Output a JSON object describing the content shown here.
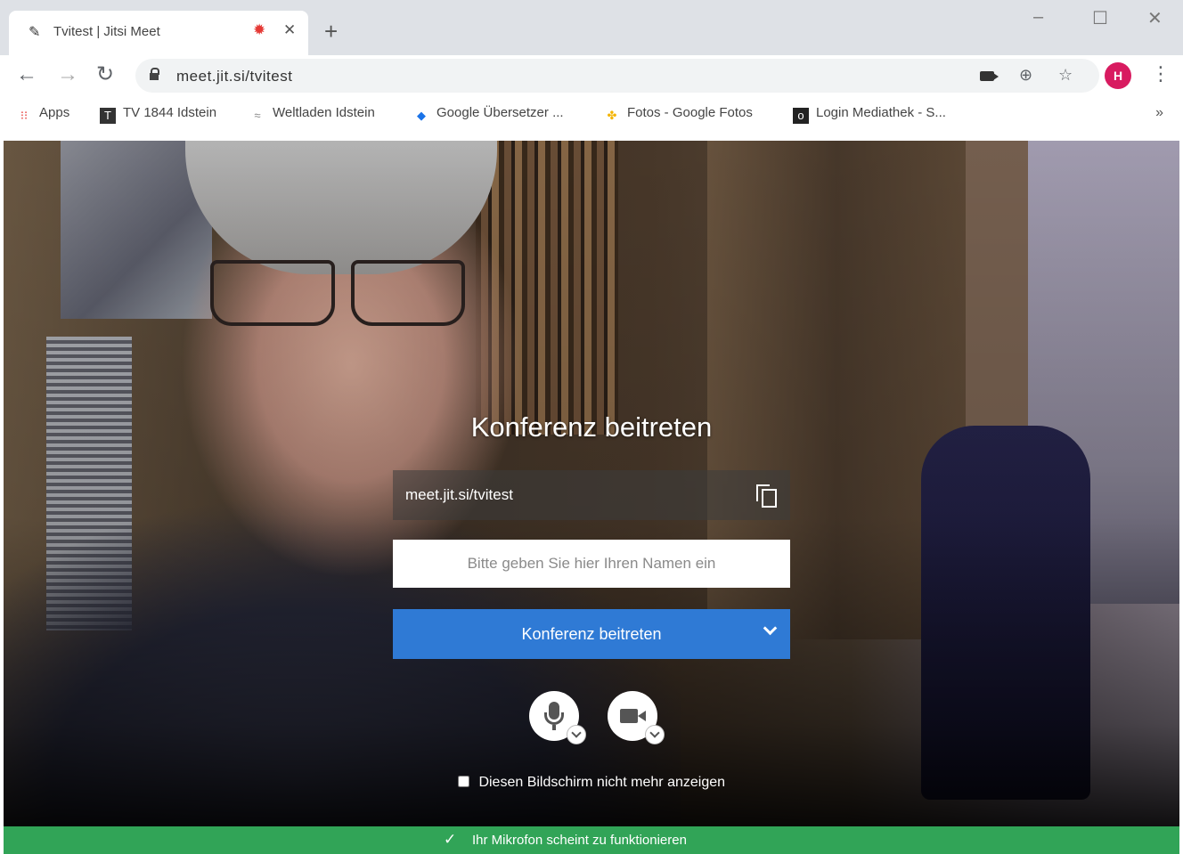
{
  "browser": {
    "tab": {
      "title": "Tvitest | Jitsi Meet",
      "favicon": "jitsi-icon",
      "audio_icon": "audio-playing-icon"
    },
    "new_tab_label": "+",
    "window_controls": {
      "minimize": "–",
      "maximize": "☐",
      "close": "✕"
    },
    "address": {
      "url": "meet.jit.si/tvitest"
    },
    "profile_initial": "H",
    "bookmarks": [
      {
        "label": "Apps",
        "icon": "apps-grid-icon"
      },
      {
        "label": "TV 1844 Idstein",
        "icon": "tv-club-icon"
      },
      {
        "label": "Weltladen Idstein",
        "icon": "weltladen-icon"
      },
      {
        "label": "Google Übersetzer ...",
        "icon": "translate-icon"
      },
      {
        "label": "Fotos - Google Fotos",
        "icon": "google-photos-icon"
      },
      {
        "label": "Login Mediathek - S...",
        "icon": "mediathek-icon"
      }
    ],
    "bookmarks_more": "»"
  },
  "meeting": {
    "title": "Konferenz beitreten",
    "room_url": "meet.jit.si/tvitest",
    "name_placeholder": "Bitte geben Sie hier Ihren Namen ein",
    "join_button_label": "Konferenz beitreten",
    "dont_show_label": "Diesen Bildschirm nicht mehr anzeigen"
  },
  "status": {
    "icon": "check-icon",
    "text": "Ihr Mikrofon scheint zu funktionieren"
  },
  "colors": {
    "join_button": "#2f7ad5",
    "status_bar": "#31a457",
    "profile_avatar": "#d81b60"
  }
}
